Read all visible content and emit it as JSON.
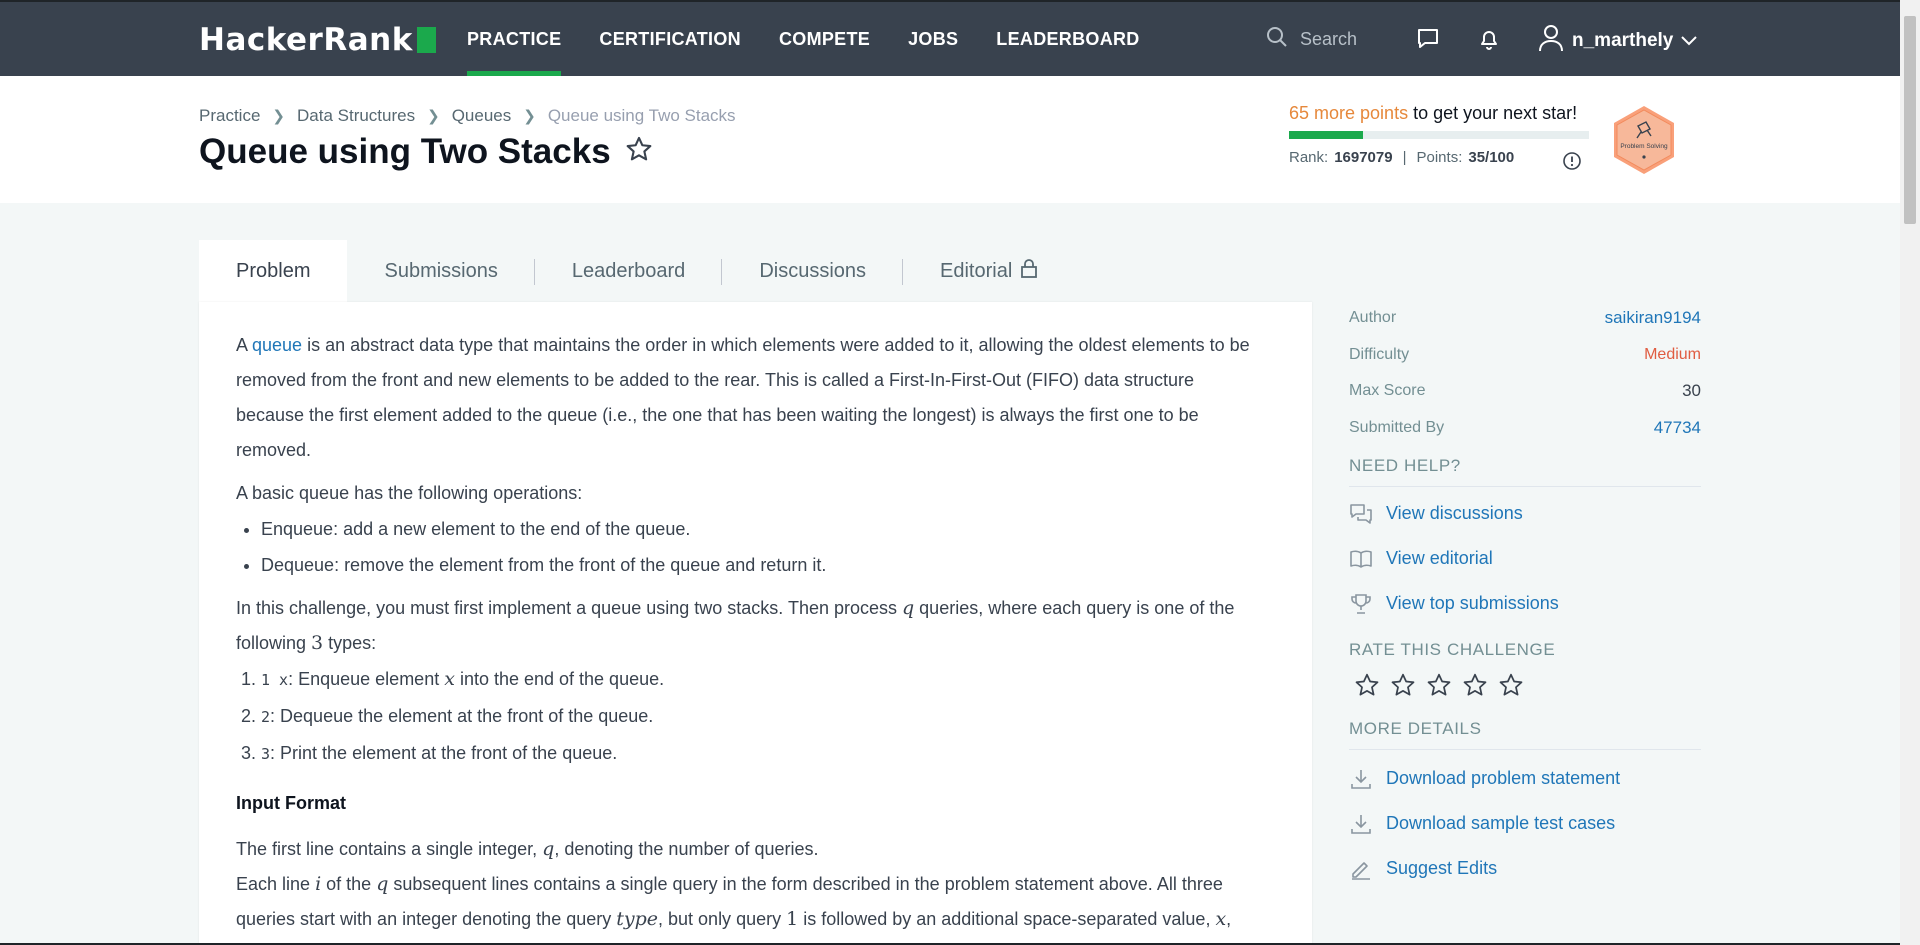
{
  "nav": {
    "logo": "HackerRank",
    "links": [
      "PRACTICE",
      "CERTIFICATION",
      "COMPETE",
      "JOBS",
      "LEADERBOARD"
    ],
    "search_placeholder": "Search",
    "username": "n_marthely"
  },
  "breadcrumb": [
    "Practice",
    "Data Structures",
    "Queues",
    "Queue using Two Stacks"
  ],
  "title": "Queue using Two Stacks",
  "points": {
    "more": "65 more points",
    "rest": " to get your next star!",
    "progress": 0.35,
    "rank_label": "Rank:",
    "rank": "1697079",
    "points_label": "Points:",
    "points": "35/100",
    "badge_text": "Problem Solving"
  },
  "tabs": [
    "Problem",
    "Submissions",
    "Leaderboard",
    "Discussions",
    "Editorial"
  ],
  "problem": {
    "p1_a": "A ",
    "p1_link": "queue",
    "p1_b": " is an abstract data type that maintains the order in which elements were added to it, allowing the oldest elements to be removed from the front and new elements to be added to the rear. This is called a First-In-First-Out (FIFO) data structure because the first element added to the queue (i.e., the one that has been waiting the longest) is always the first one to be removed.",
    "p2": "A basic queue has the following operations:",
    "ops": [
      "Enqueue: add a new element to the end of the queue.",
      "Dequeue: remove the element from the front of the queue and return it."
    ],
    "p3_a": "In this challenge, you must first implement a queue using two stacks. Then process ",
    "p3_q": "q",
    "p3_b": " queries, where each query is one of the following ",
    "p3_n": "3",
    "p3_c": " types:",
    "types": {
      "t1_code": "1 x",
      "t1_a": ": Enqueue element ",
      "t1_x": "x",
      "t1_b": " into the end of the queue.",
      "t2_code": "2",
      "t2": ": Dequeue the element at the front of the queue.",
      "t3_code": "3",
      "t3": ": Print the element at the front of the queue."
    },
    "input_heading": "Input Format",
    "in1_a": "The first line contains a single integer, ",
    "in1_q": "q",
    "in1_b": ", denoting the number of queries.",
    "in2_a": "Each line ",
    "in2_i": "i",
    "in2_b": " of the ",
    "in2_q": "q",
    "in2_c": " subsequent lines contains a single query in the form described in the problem statement above. All three queries start with an integer denoting the query ",
    "in2_type": "type",
    "in2_d": ", but only query ",
    "in2_one": "1",
    "in2_e": " is followed by an additional space-separated value, ",
    "in2_x": "x",
    "in2_f": ","
  },
  "sidebar": {
    "meta": [
      {
        "label": "Author",
        "value": "saikiran9194"
      },
      {
        "label": "Difficulty",
        "value": "Medium"
      },
      {
        "label": "Max Score",
        "value": "30"
      },
      {
        "label": "Submitted By",
        "value": "47734"
      }
    ],
    "need_help": "NEED HELP?",
    "help": [
      "View discussions",
      "View editorial",
      "View top submissions"
    ],
    "rate": "RATE THIS CHALLENGE",
    "more": "MORE DETAILS",
    "details": [
      "Download problem statement",
      "Download sample test cases",
      "Suggest Edits"
    ]
  },
  "colors": {
    "nav_bg": "#39424e",
    "accent_green": "#1ba94c",
    "link_blue": "#1f76b8",
    "points_orange": "#e6883b",
    "difficulty_medium": "#e05c41"
  }
}
